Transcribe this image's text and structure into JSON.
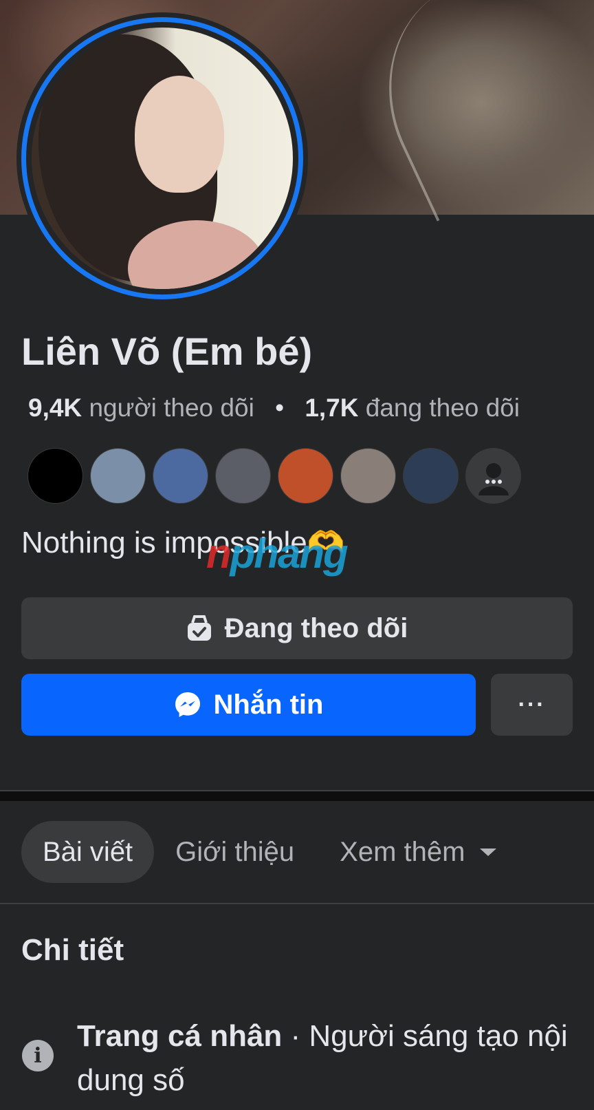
{
  "profile": {
    "name": "Liên Võ (Em bé)",
    "followers_count": "9,4K",
    "followers_label": "người theo dõi",
    "separator": "•",
    "following_count": "1,7K",
    "following_label": "đang theo dõi",
    "bio": "Nothing is impossible🫶"
  },
  "watermark": {
    "part1": "n",
    "part2": "phang"
  },
  "friends": [
    {
      "color": "#000000"
    },
    {
      "color": "#7b8fa8"
    },
    {
      "color": "#4c6aa0"
    },
    {
      "color": "#5b5e66"
    },
    {
      "color": "#c0502a"
    },
    {
      "color": "#8a7f78"
    },
    {
      "color": "#2d3d55"
    },
    {
      "color": "#3a3b3c"
    }
  ],
  "actions": {
    "follow_label": "Đang theo dõi",
    "message_label": "Nhắn tin",
    "more_label": "···"
  },
  "tabs": {
    "posts": "Bài viết",
    "about": "Giới thiệu",
    "more": "Xem thêm"
  },
  "details": {
    "title": "Chi tiết",
    "type_label": "Trang cá nhân",
    "type_sep": " · ",
    "type_value": "Người sáng tạo nội dung số",
    "info_icon_glyph": "i"
  },
  "colors": {
    "background": "#242526",
    "accent_blue": "#0866ff",
    "button_gray": "#3a3b3c"
  }
}
